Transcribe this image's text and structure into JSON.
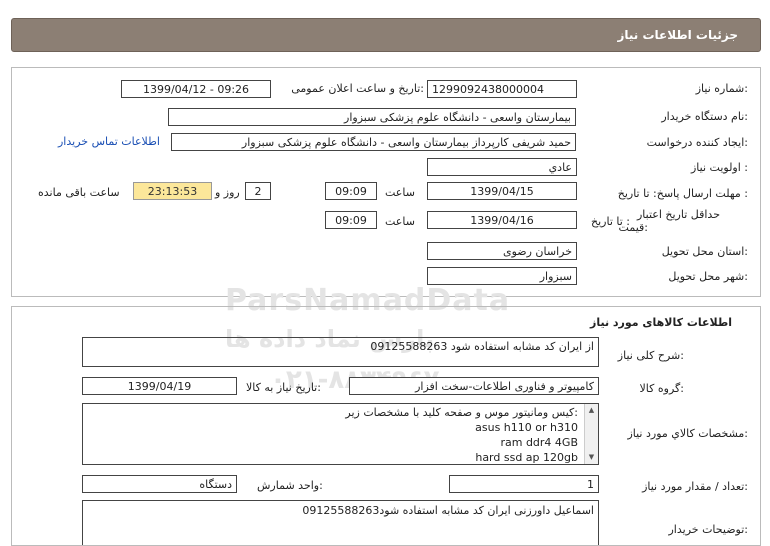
{
  "header": {
    "title": "جزئیات اطلاعات نیاز"
  },
  "info": {
    "need_no_label": "شماره نیاز:",
    "need_no": "1299092438000004",
    "announce_label": "تاریخ و ساعت اعلان عمومی:",
    "announce_value": "1399/04/12 - 09:26",
    "buyer_org_label": "نام دستگاه خریدار:",
    "buyer_org": "بیمارستان واسعی - دانشگاه علوم پزشکی سبزوار",
    "creator_label": "ایجاد کننده درخواست:",
    "creator": "حمید شریفی کارپرداز بیمارستان واسعی - دانشگاه علوم پزشکی سبزوار",
    "contact_link": "اطلاعات تماس خریدار",
    "priority_label": "اولویت نیاز :",
    "priority": "عادي",
    "deadline_label": "مهلت ارسال پاسخ: تا تاریخ :",
    "deadline_date": "1399/04/15",
    "time_label": "ساعت",
    "deadline_time": "09:09",
    "days_value": "2",
    "days_label": "روز و",
    "remaining_time": "23:13:53",
    "remaining_label": "ساعت باقی مانده",
    "min_validity_label1": "حداقل تاریخ اعتبار",
    "min_validity_label2": "قیمت:",
    "until_date_label": "تا تاریخ :",
    "validity_date": "1399/04/16",
    "validity_time": "09:09",
    "province_label": "استان محل تحویل:",
    "province": "خراسان رضوی",
    "city_label": "شهر محل تحویل:",
    "city": "سبزوار"
  },
  "goods": {
    "section_title": "اطلاعات کالاهای مورد نیاز",
    "summary_label": "شرح کلی نیاز:",
    "summary": "از ایران کد مشابه استفاده شود  09125588263",
    "group_label": "گروه کالا:",
    "group": "کامپیوتر و فناوری اطلاعات-سخت افزار",
    "needdate_label": "تاریخ نیاز به کالا:",
    "needdate": "1399/04/19",
    "specs_label": "مشخصات کالاي مورد نیاز:",
    "spec_lines": [
      "کیس ومانیتور موس و صفحه کلید  با مشخصات زیر:",
      "asus h110  or h310",
      "ram ddr4 4GB",
      "hard ssd ap 120gb"
    ],
    "qty_label": "تعداد / مقدار مورد نیاز:",
    "qty": "1",
    "unit_label": "واحد شمارش:",
    "unit": "دستگاه",
    "buyer_notes_label": "توضیحات خریدار:",
    "buyer_notes": "اسماعیل داورزنی ایران کد مشابه استفاده شود09125588263"
  },
  "watermark": {
    "brand": "ParsNamadData",
    "persian": "پارس نماد داده ها",
    "phone": "۰۲۱-۸۸۳۴۹۶۷۰"
  }
}
